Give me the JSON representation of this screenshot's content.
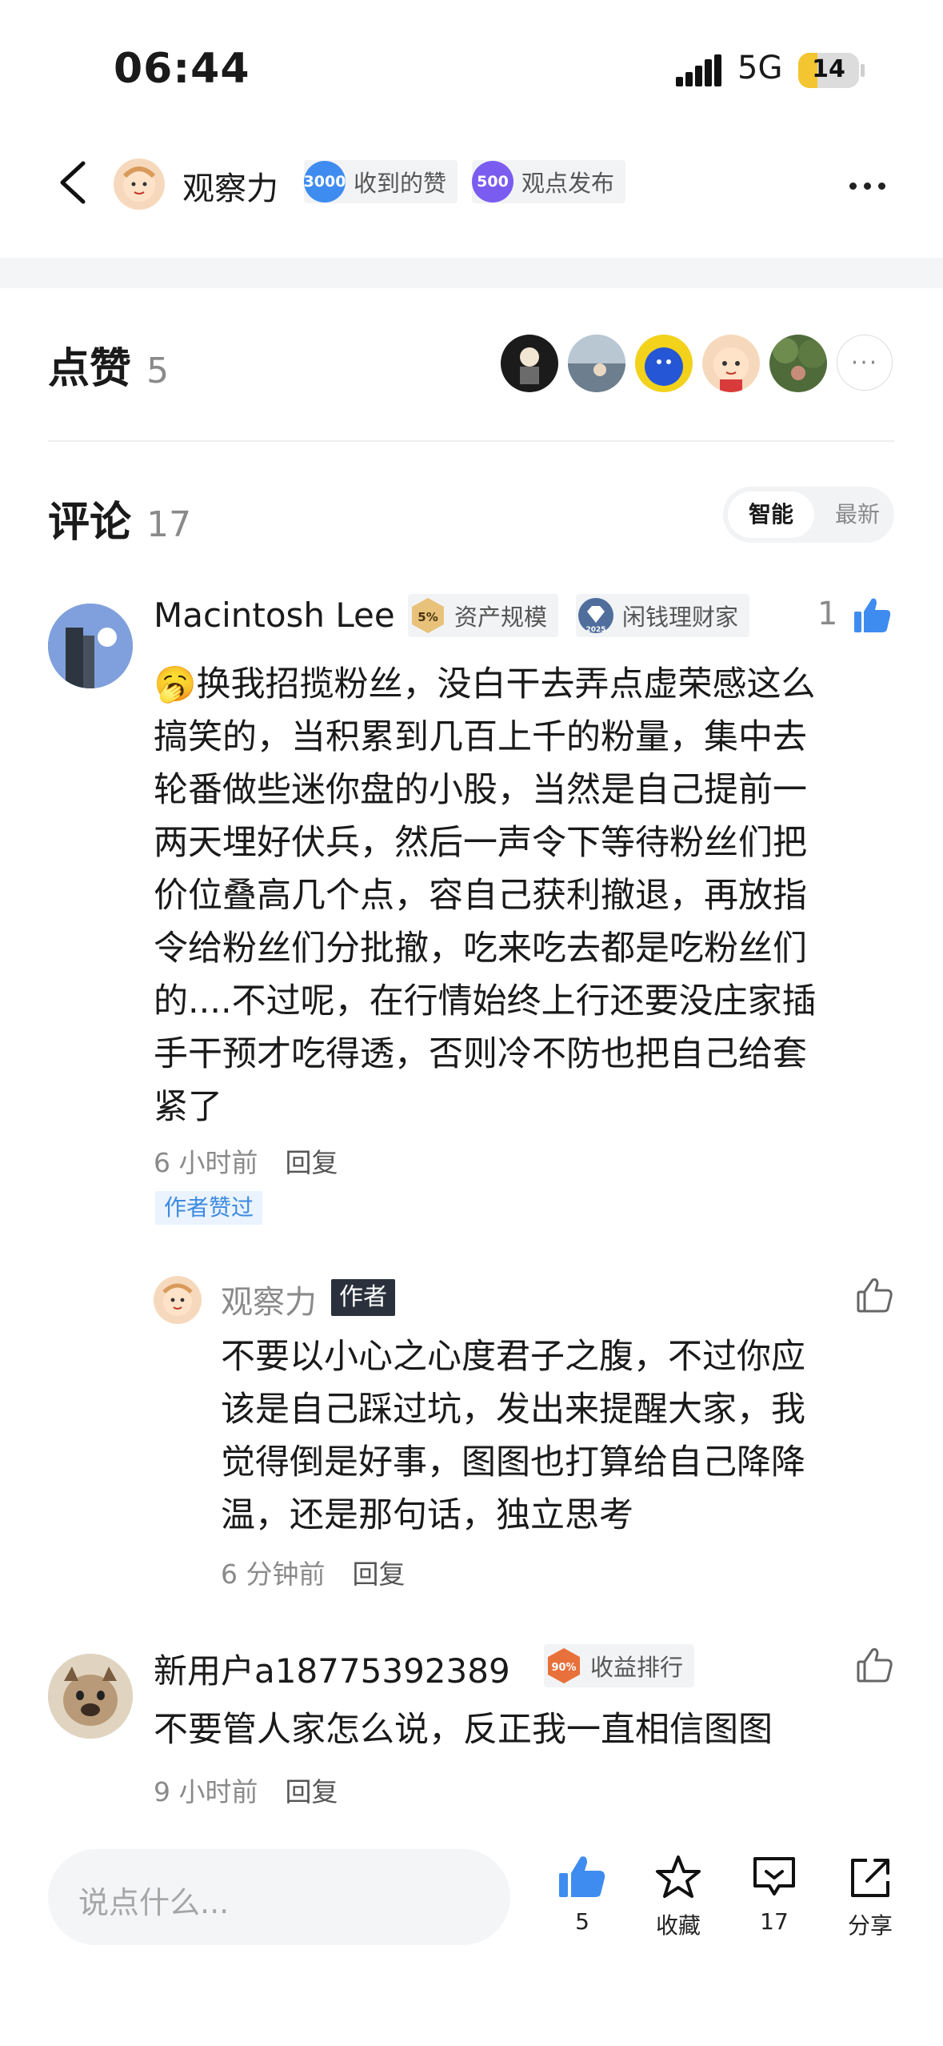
{
  "status": {
    "time": "06:44",
    "network": "5G",
    "battery": "14"
  },
  "header": {
    "name": "观察力",
    "badges": [
      {
        "number": "3000",
        "label": "收到的赞",
        "color": "#3f8cf0"
      },
      {
        "number": "500",
        "label": "观点发布",
        "color": "#7b5cf0"
      }
    ]
  },
  "likes": {
    "title": "点赞",
    "count": "5"
  },
  "comments": {
    "title": "评论",
    "count": "17",
    "sort": {
      "active": "智能",
      "inactive": "最新"
    },
    "items": [
      {
        "name": "Macintosh Lee",
        "tag1_icon": "5%",
        "tag1": "资产规模",
        "tag2_icon": "2025",
        "tag2": "闲钱理财家",
        "like_count": "1",
        "emoji": "🥱",
        "lines": [
          "换我招揽粉丝，没白干去弄点虚荣感这么",
          "搞笑的，当积累到几百上千的粉量，集中去",
          "轮番做些迷你盘的小股，当然是自己提前一",
          "两天埋好伏兵，然后一声令下等待粉丝们把",
          "价位叠高几个点，容自己获利撤退，再放指",
          "令给粉丝们分批撤，吃来吃去都是吃粉丝们",
          "的....不过呢，在行情始终上行还要没庄家插",
          "手干预才吃得透，否则冷不防也把自己给套",
          "紧了"
        ],
        "time": "6 小时前",
        "reply": "回复",
        "author_liked": "作者赞过",
        "sub_reply": {
          "name": "观察力",
          "badge": "作者",
          "lines": [
            "不要以小心之心度君子之腹，不过你应",
            "该是自己踩过坑，发出来提醒大家，我",
            "觉得倒是好事，图图也打算给自己降降",
            "温，还是那句话，独立思考"
          ],
          "time": "6 分钟前",
          "reply": "回复"
        }
      },
      {
        "name": "新用户a18775392389",
        "tag1_icon": "90%",
        "tag1": "收益排行",
        "text": "不要管人家怎么说，反正我一直相信图图",
        "time": "9 小时前",
        "reply": "回复"
      }
    ]
  },
  "bottom": {
    "placeholder": "说点什么...",
    "like_count": "5",
    "collect": "收藏",
    "comment_count": "17",
    "share": "分享"
  },
  "colors": {
    "accent_blue": "#3f8cf0",
    "tag_gold": "#e8c27a",
    "tag_orange": "#e8703a"
  }
}
